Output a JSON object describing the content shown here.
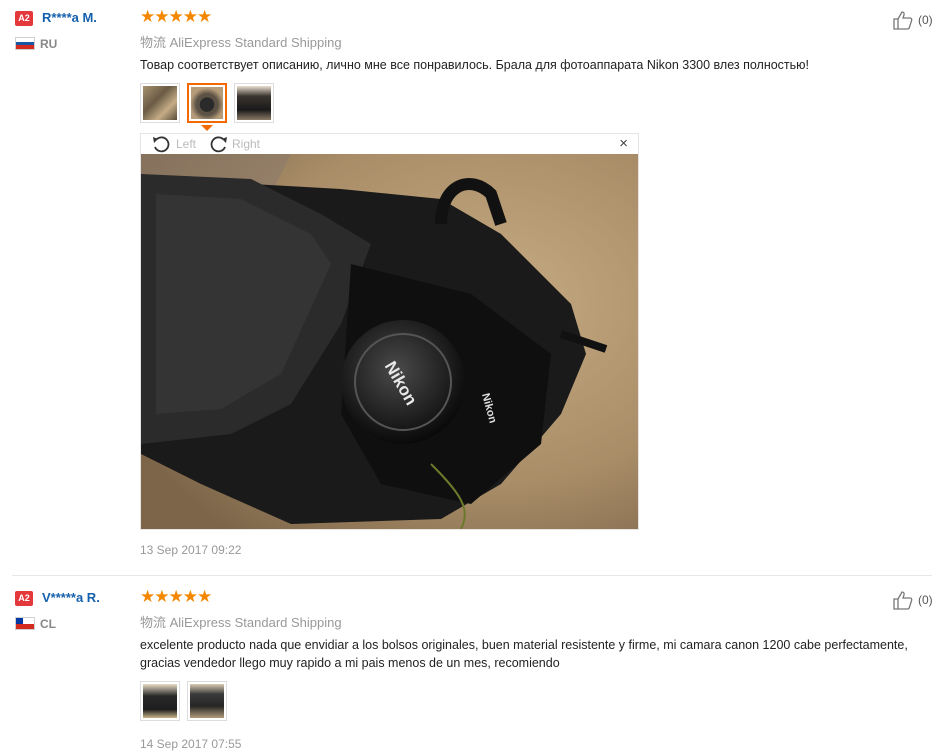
{
  "reviews": [
    {
      "badge": "A2",
      "user": "R****a M.",
      "country": "RU",
      "stars": "★★★★★",
      "shipping": "物流 AliExpress Standard Shipping",
      "text": "Товар соответствует описанию, лично мне все понравилось. Брала для фотоаппарата Nikon 3300 влез полностью!",
      "likes": "(0)",
      "viewer": {
        "left": "Left",
        "right": "Right",
        "close": "×",
        "lens_text": "Nikon",
        "body_text": "Nikon"
      },
      "date": "13 Sep 2017 09:22"
    },
    {
      "badge": "A2",
      "user": "V*****a R.",
      "country": "CL",
      "stars": "★★★★★",
      "shipping": "物流 AliExpress Standard Shipping",
      "text": "excelente producto nada que envidiar a los bolsos originales, buen material resistente y firme, mi camara canon 1200 cabe perfectamente, gracias vendedor llego muy rapido a mi pais menos de un mes, recomiendo",
      "likes": "(0)",
      "date": "14 Sep 2017 07:55"
    }
  ],
  "colors": {
    "accent": "#f56a00",
    "username": "#1560ad",
    "star": "#f38800",
    "badge": "#e4393c"
  },
  "icons": [
    "thumbs-up-icon",
    "rotate-left-icon",
    "rotate-right-icon",
    "close-icon",
    "flag-ru-icon",
    "flag-cl-icon"
  ]
}
